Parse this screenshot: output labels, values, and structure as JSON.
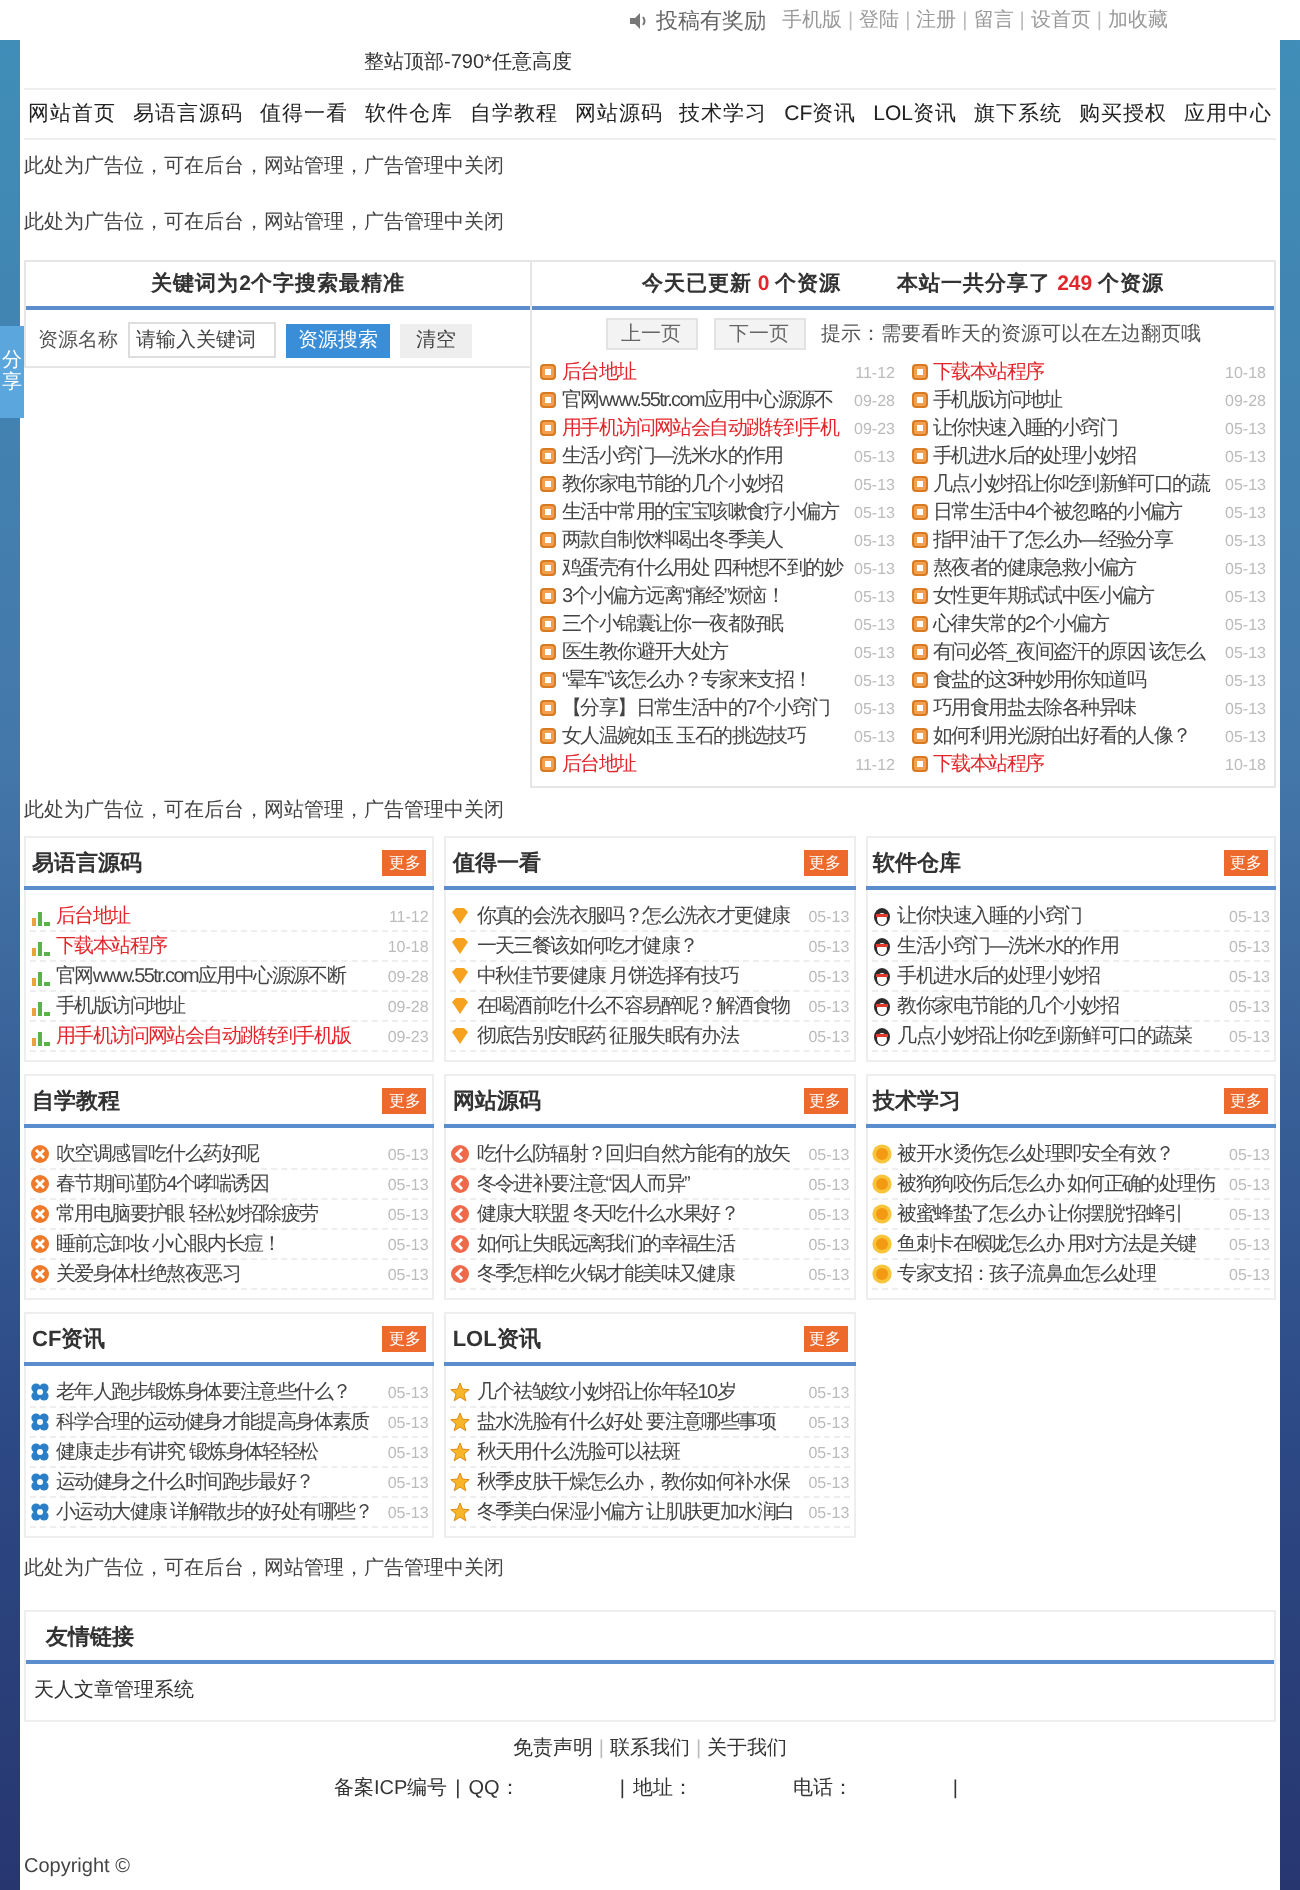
{
  "top_bar": {
    "promo": "投稿有奖励",
    "separator": "|",
    "links": [
      "手机版",
      "登陆",
      "注册",
      "留言",
      "设首页",
      "加收藏"
    ]
  },
  "header_text": "整站顶部-790*任意高度",
  "share_tab": "分享",
  "nav": [
    "网站首页",
    "易语言源码",
    "值得一看",
    "软件仓库",
    "自学教程",
    "网站源码",
    "技术学习",
    "CF资讯",
    "LOL资讯",
    "旗下系统",
    "购买授权",
    "应用中心"
  ],
  "ads": [
    "此处为广告位，可在后台，网站管理，广告管理中关闭",
    "此处为广告位，可在后台，网站管理，广告管理中关闭",
    "此处为广告位，可在后台，网站管理，广告管理中关闭",
    "此处为广告位，可在后台，网站管理，广告管理中关闭"
  ],
  "search": {
    "title": "关键词为2个字搜索最精准",
    "label": "资源名称",
    "placeholder": "请输入关键词",
    "search_button": "资源搜索",
    "clear_button": "清空"
  },
  "updates": {
    "today": {
      "prefix": "今天已更新",
      "count": "0",
      "suffix": "个资源"
    },
    "total": {
      "prefix": "本站一共分享了",
      "count": "249",
      "suffix": "个资源"
    },
    "prev_button": "上一页",
    "next_button": "下一页",
    "tip": "提示：需要看昨天的资源可以在左边翻页哦",
    "columns": [
      [
        {
          "title": "后台地址",
          "date": "11-12",
          "hot": true
        },
        {
          "title": "官网www.55tr.com应用中心源源不",
          "date": "09-28",
          "hot": false
        },
        {
          "title": "用手机访问网站会自动跳转到手机",
          "date": "09-23",
          "hot": true
        },
        {
          "title": "生活小窍门—洗米水的作用",
          "date": "05-13",
          "hot": false
        },
        {
          "title": "教你家电节能的几个小妙招",
          "date": "05-13",
          "hot": false
        },
        {
          "title": "生活中常用的宝宝咳嗽食疗小偏方",
          "date": "05-13",
          "hot": false
        },
        {
          "title": "两款自制饮料喝出冬季美人",
          "date": "05-13",
          "hot": false
        },
        {
          "title": "鸡蛋壳有什么用处 四种想不到的妙",
          "date": "05-13",
          "hot": false
        },
        {
          "title": "3个小偏方远离“痛经”烦恼！",
          "date": "05-13",
          "hot": false
        },
        {
          "title": "三个小锦囊让你一夜都好眠",
          "date": "05-13",
          "hot": false
        },
        {
          "title": "医生教你避开大处方",
          "date": "05-13",
          "hot": false
        },
        {
          "title": "“晕车”该怎么办？专家来支招！",
          "date": "05-13",
          "hot": false
        },
        {
          "title": "【分享】日常生活中的7个小窍门",
          "date": "05-13",
          "hot": false
        },
        {
          "title": "女人温婉如玉 玉石的挑选技巧",
          "date": "05-13",
          "hot": false
        },
        {
          "title": "后台地址",
          "date": "11-12",
          "hot": true
        }
      ],
      [
        {
          "title": "下载本站程序",
          "date": "10-18",
          "hot": true
        },
        {
          "title": "手机版访问地址",
          "date": "09-28",
          "hot": false
        },
        {
          "title": "让你快速入睡的小窍门",
          "date": "05-13",
          "hot": false
        },
        {
          "title": "手机进水后的处理小妙招",
          "date": "05-13",
          "hot": false
        },
        {
          "title": "几点小妙招让你吃到新鲜可口的蔬",
          "date": "05-13",
          "hot": false
        },
        {
          "title": "日常生活中4个被忽略的小偏方",
          "date": "05-13",
          "hot": false
        },
        {
          "title": "指甲油干了怎么办—经验分享",
          "date": "05-13",
          "hot": false
        },
        {
          "title": "熬夜者的健康急救小偏方",
          "date": "05-13",
          "hot": false
        },
        {
          "title": "女性更年期试试中医小偏方",
          "date": "05-13",
          "hot": false
        },
        {
          "title": "心律失常的2个小偏方",
          "date": "05-13",
          "hot": false
        },
        {
          "title": "有问必答_夜间盗汗的原因 该怎么",
          "date": "05-13",
          "hot": false
        },
        {
          "title": "食盐的这3种妙用你知道吗",
          "date": "05-13",
          "hot": false
        },
        {
          "title": "巧用食用盐去除各种异味",
          "date": "05-13",
          "hot": false
        },
        {
          "title": "如何利用光源拍出好看的人像？",
          "date": "05-13",
          "hot": false
        },
        {
          "title": "下载本站程序",
          "date": "10-18",
          "hot": true
        }
      ]
    ]
  },
  "panels": [
    {
      "title": "易语言源码",
      "more": "更多",
      "kind": "bars",
      "items": [
        {
          "title": "后台地址",
          "date": "11-12",
          "hot": true
        },
        {
          "title": "下载本站程序",
          "date": "10-18",
          "hot": true
        },
        {
          "title": "官网www.55tr.com应用中心源源不断",
          "date": "09-28",
          "hot": false
        },
        {
          "title": "手机版访问地址",
          "date": "09-28",
          "hot": false
        },
        {
          "title": "用手机访问网站会自动跳转到手机版",
          "date": "09-23",
          "hot": true
        }
      ]
    },
    {
      "title": "值得一看",
      "more": "更多",
      "kind": "gem",
      "items": [
        {
          "title": "你真的会洗衣服吗？怎么洗衣才更健康",
          "date": "05-13",
          "hot": false
        },
        {
          "title": "一天三餐该如何吃才健康？",
          "date": "05-13",
          "hot": false
        },
        {
          "title": "中秋佳节要健康 月饼选择有技巧",
          "date": "05-13",
          "hot": false
        },
        {
          "title": "在喝酒前吃什么不容易醉呢？解酒食物",
          "date": "05-13",
          "hot": false
        },
        {
          "title": "彻底告别安眠药 征服失眠有办法",
          "date": "05-13",
          "hot": false
        }
      ]
    },
    {
      "title": "软件仓库",
      "more": "更多",
      "kind": "penguin",
      "items": [
        {
          "title": "让你快速入睡的小窍门",
          "date": "05-13",
          "hot": false
        },
        {
          "title": "生活小窍门—洗米水的作用",
          "date": "05-13",
          "hot": false
        },
        {
          "title": "手机进水后的处理小妙招",
          "date": "05-13",
          "hot": false
        },
        {
          "title": "教你家电节能的几个小妙招",
          "date": "05-13",
          "hot": false
        },
        {
          "title": "几点小妙招让你吃到新鲜可口的蔬菜",
          "date": "05-13",
          "hot": false
        }
      ]
    },
    {
      "title": "自学教程",
      "more": "更多",
      "kind": "cross",
      "items": [
        {
          "title": "吹空调感冒吃什么药好呢",
          "date": "05-13",
          "hot": false
        },
        {
          "title": "春节期间谨防4个哮喘诱因",
          "date": "05-13",
          "hot": false
        },
        {
          "title": "常用电脑要护眼 轻松妙招除疲劳",
          "date": "05-13",
          "hot": false
        },
        {
          "title": "睡前忘卸妆 小心眼内长痘！",
          "date": "05-13",
          "hot": false
        },
        {
          "title": "关爱身体杜绝熬夜恶习",
          "date": "05-13",
          "hot": false
        }
      ]
    },
    {
      "title": "网站源码",
      "more": "更多",
      "kind": "back",
      "items": [
        {
          "title": "吃什么防辐射？回归自然方能有的放矢",
          "date": "05-13",
          "hot": false
        },
        {
          "title": "冬令进补要注意“因人而异”",
          "date": "05-13",
          "hot": false
        },
        {
          "title": "健康大联盟 冬天吃什么水果好？",
          "date": "05-13",
          "hot": false
        },
        {
          "title": "如何让失眠远离我们的幸福生活",
          "date": "05-13",
          "hot": false
        },
        {
          "title": "冬季怎样吃火锅才能美味又健康",
          "date": "05-13",
          "hot": false
        }
      ]
    },
    {
      "title": "技术学习",
      "more": "更多",
      "kind": "sun",
      "items": [
        {
          "title": "被开水烫伤怎么处理即安全有效？",
          "date": "05-13",
          "hot": false
        },
        {
          "title": "被狗狗咬伤后怎么办 如何正确的处理伤",
          "date": "05-13",
          "hot": false
        },
        {
          "title": "被蜜蜂蛰了怎么办 让你摆脱“招蜂引",
          "date": "05-13",
          "hot": false
        },
        {
          "title": "鱼刺卡在喉咙怎么办 用对方法是关键",
          "date": "05-13",
          "hot": false
        },
        {
          "title": "专家支招：孩子流鼻血怎么处理",
          "date": "05-13",
          "hot": false
        }
      ]
    },
    {
      "title": "CF资讯",
      "more": "更多",
      "kind": "flower",
      "items": [
        {
          "title": "老年人跑步锻炼身体要注意些什么？",
          "date": "05-13",
          "hot": false
        },
        {
          "title": "科学合理的运动健身才能提高身体素质",
          "date": "05-13",
          "hot": false
        },
        {
          "title": "健康走步有讲究 锻炼身体轻轻松",
          "date": "05-13",
          "hot": false
        },
        {
          "title": "运动健身之什么时间跑步最好？",
          "date": "05-13",
          "hot": false
        },
        {
          "title": "小运动大健康 详解散步的好处有哪些？",
          "date": "05-13",
          "hot": false
        }
      ]
    },
    {
      "title": "LOL资讯",
      "more": "更多",
      "kind": "star",
      "items": [
        {
          "title": "几个祛皱纹小妙招让你年轻10岁",
          "date": "05-13",
          "hot": false
        },
        {
          "title": "盐水洗脸有什么好处 要注意哪些事项",
          "date": "05-13",
          "hot": false
        },
        {
          "title": "秋天用什么洗脸可以祛斑",
          "date": "05-13",
          "hot": false
        },
        {
          "title": "秋季皮肤干燥怎么办，教你如何补水保",
          "date": "05-13",
          "hot": false
        },
        {
          "title": "冬季美白保湿小偏方 让肌肤更加水润白",
          "date": "05-13",
          "hot": false
        }
      ]
    }
  ],
  "friend_links": {
    "title": "友情链接",
    "links": [
      "天人文章管理系统"
    ]
  },
  "footer": {
    "separator": "|",
    "links": [
      "免责声明",
      "联系我们",
      "关于我们"
    ],
    "info": [
      {
        "kind": "label",
        "text": "备案ICP编号"
      },
      {
        "kind": "sep",
        "text": "|"
      },
      {
        "kind": "field",
        "text": "QQ："
      },
      {
        "kind": "sep",
        "text": "|"
      },
      {
        "kind": "field",
        "text": "地址："
      },
      {
        "kind": "field",
        "text": "电话："
      },
      {
        "kind": "sep",
        "text": "|"
      }
    ],
    "copyright": "Copyright ©"
  }
}
